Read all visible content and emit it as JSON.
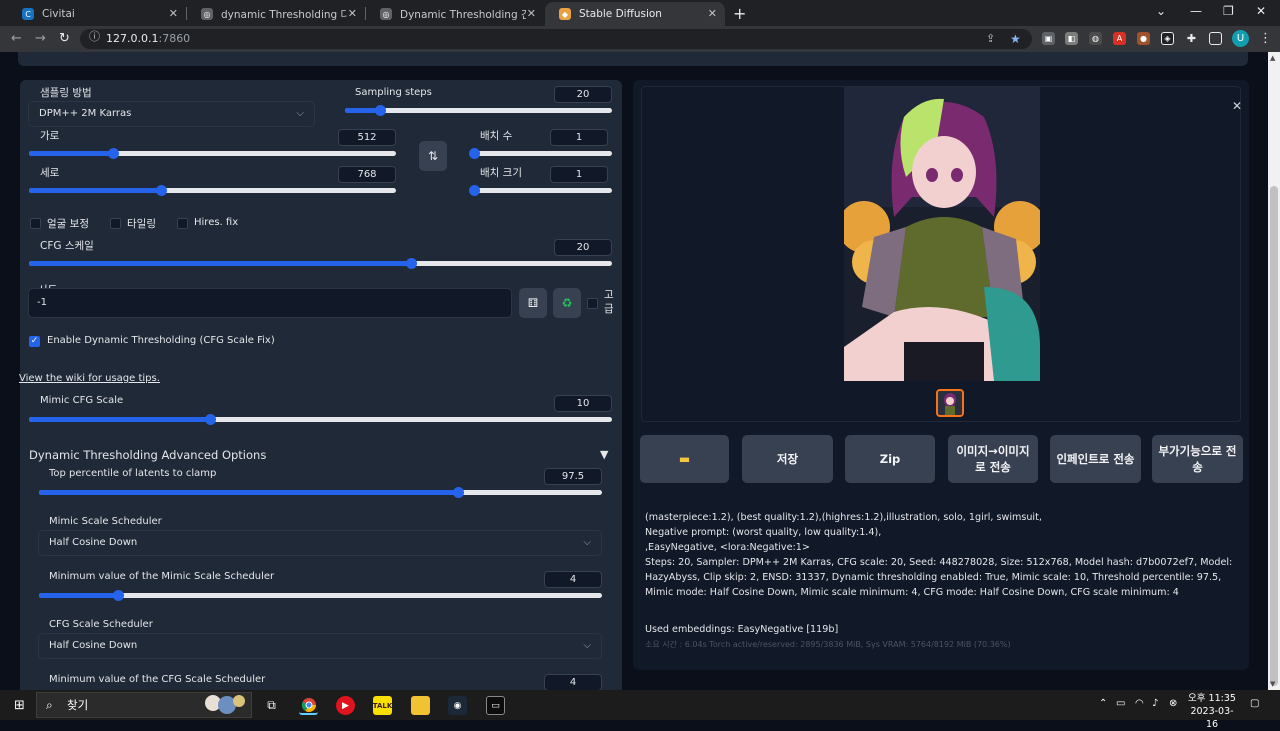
{
  "browser": {
    "tabs": [
      {
        "title": "Civitai"
      },
      {
        "title": "dynamic Thresholding 다이나믹"
      },
      {
        "title": "Dynamic Thresholding 간단 설명"
      },
      {
        "title": "Stable Diffusion",
        "active": true
      }
    ],
    "url_host": "127.0.0.1",
    "url_port": ":7860",
    "avatar_letter": "U"
  },
  "settings": {
    "sampling_method_label": "샘플링 방법",
    "sampling_method_value": "DPM++ 2M Karras",
    "sampling_steps_label": "Sampling steps",
    "sampling_steps_value": "20",
    "sampling_steps_fraction": 0.13,
    "width_label": "가로",
    "width_value": "512",
    "width_fraction": 0.23,
    "height_label": "세로",
    "height_value": "768",
    "height_fraction": 0.36,
    "batch_count_label": "배치 수",
    "batch_count_value": "1",
    "batch_count_fraction": 0.0,
    "batch_size_label": "배치 크기",
    "batch_size_value": "1",
    "batch_size_fraction": 0.0,
    "restore_faces_label": "얼굴 보정",
    "tiling_label": "타일링",
    "hires_fix_label": "Hires. fix",
    "cfg_scale_label": "CFG 스케일",
    "cfg_scale_value": "20",
    "cfg_scale_fraction": 0.655,
    "seed_label": "시드",
    "seed_value": "-1",
    "extra_label": "고급",
    "dynthres_enable_label": "Enable Dynamic Thresholding (CFG Scale Fix)",
    "wiki_text": "View the wiki for usage tips.",
    "mimic_cfg_label": "Mimic CFG Scale",
    "mimic_cfg_value": "10",
    "mimic_cfg_fraction": 0.31,
    "advanced_title": "Dynamic Thresholding Advanced Options",
    "top_percentile_label": "Top percentile of latents to clamp",
    "top_percentile_value": "97.5",
    "top_percentile_fraction": 0.745,
    "mimic_sched_label": "Mimic Scale Scheduler",
    "mimic_sched_value": "Half Cosine Down",
    "mimic_min_label": "Minimum value of the Mimic Scale Scheduler",
    "mimic_min_value": "4",
    "mimic_min_fraction": 0.14,
    "cfg_sched_label": "CFG Scale Scheduler",
    "cfg_sched_value": "Half Cosine Down",
    "cfg_min_label": "Minimum value of the CFG Scale Scheduler",
    "cfg_min_value": "4"
  },
  "output": {
    "buttons": [
      "",
      "저장",
      "Zip",
      "이미지→이미지로 전송",
      "인페인트로 전송",
      "부가기능으로 전송"
    ],
    "info_lines": [
      "(masterpiece:1.2), (best quality:1.2),(highres:1.2),illustration, solo, 1girl, swimsuit,",
      "Negative prompt: (worst quality, low quality:1.4),",
      ",EasyNegative, <lora:Negative:1>",
      "Steps: 20, Sampler: DPM++ 2M Karras, CFG scale: 20, Seed: 448278028, Size: 512x768, Model hash: d7b0072ef7, Model: HazyAbyss, Clip skip: 2, ENSD: 31337, Dynamic thresholding enabled: True, Mimic scale: 10, Threshold percentile: 97.5, Mimic mode: Half Cosine Down, Mimic scale minimum: 4, CFG mode: Half Cosine Down, CFG scale minimum: 4"
    ],
    "embeddings_line": "Used embeddings: EasyNegative [119b]",
    "timing_line": "소요 시간 : 6.04s  Torch active/reserved: 2895/3836 MiB, Sys VRAM: 5764/8192 MiB (70.36%)"
  },
  "taskbar": {
    "search_text": "찾기",
    "clock_time": "오후 11:35",
    "clock_date": "2023-03-16"
  }
}
